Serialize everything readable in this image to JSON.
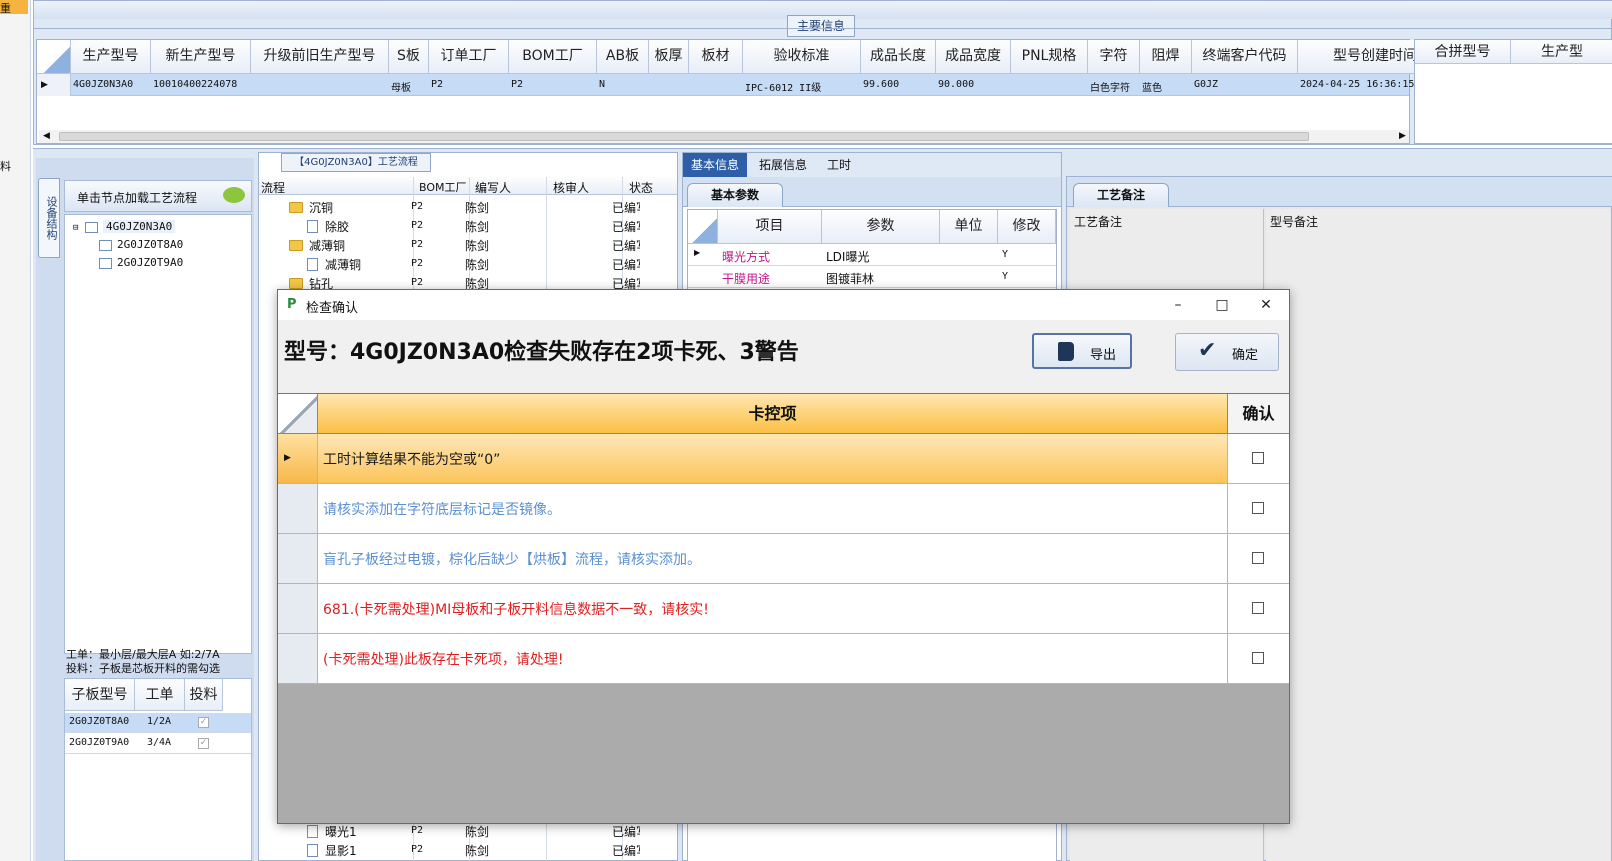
{
  "main_info": {
    "title": "主要信息",
    "columns": [
      "生产型号",
      "新生产型号",
      "升级前旧生产型号",
      "S板",
      "订单工厂",
      "BOM工厂",
      "AB板",
      "板厚",
      "板材",
      "验收标准",
      "成品长度",
      "成品宽度",
      "PNL规格",
      "字符",
      "阻焊",
      "终端客户代码",
      "型号创建时间"
    ],
    "row": [
      "4G0JZ0N3A0",
      "10010400224078",
      "",
      "母板",
      "P2",
      "P2",
      "N",
      "",
      "",
      "IPC-6012 II级",
      "99.600",
      "90.000",
      "",
      "白色字符",
      "蓝色",
      "G0JZ",
      "2024-04-25 16:36:15"
    ],
    "extra_columns": [
      "合拼型号",
      "生产型"
    ]
  },
  "left_panel": {
    "vertical_tab": "设备结构",
    "hint": "单击节点加载工艺流程",
    "tree": [
      "4G0JZ0N3A0",
      "2G0JZ0T8A0",
      "2G0JZ0T9A0"
    ],
    "note_line1": "工单：最小层/最大层A 如:2/7A",
    "note_line2": "投料：子板是芯板开料的需勾选",
    "sub_columns": [
      "子板型号",
      "工单",
      "投料"
    ],
    "sub_rows": [
      {
        "model": "2G0JZ0T8A0",
        "order": "1/2A"
      },
      {
        "model": "2G0JZ0T9A0",
        "order": "3/4A"
      }
    ]
  },
  "flow": {
    "title": "【4G0JZ0N3A0】工艺流程",
    "columns": [
      "流程",
      "BOM工厂",
      "编写人",
      "核审人",
      "状态"
    ],
    "rows": [
      {
        "name": "沉铜",
        "factory": "P2",
        "writer": "陈剑",
        "status": "已编写"
      },
      {
        "name": "除胶",
        "factory": "P2",
        "writer": "陈剑",
        "status": "已编写"
      },
      {
        "name": "减薄铜",
        "factory": "P2",
        "writer": "陈剑",
        "status": "已编写"
      },
      {
        "name": "减薄铜",
        "factory": "P2",
        "writer": "陈剑",
        "status": "已编写"
      },
      {
        "name": "钻孔",
        "factory": "P2",
        "writer": "陈剑",
        "status": "已编写"
      }
    ],
    "bottom_rows": [
      {
        "name": "曝光1",
        "factory": "P2",
        "writer": "陈剑",
        "status": "已编写"
      },
      {
        "name": "显影1",
        "factory": "P2",
        "writer": "陈剑",
        "status": "已编写"
      }
    ]
  },
  "info_tabs": [
    "基本信息",
    "拓展信息",
    "工时"
  ],
  "basic_params": {
    "tab": "基本参数",
    "columns": [
      "项目",
      "参数",
      "单位",
      "修改"
    ],
    "rows": [
      {
        "item": "曝光方式",
        "param": "LDI曝光",
        "unit": "",
        "modify": "Y"
      },
      {
        "item": "干膜用途",
        "param": "图镀菲林",
        "unit": "",
        "modify": "Y"
      }
    ]
  },
  "remarks": {
    "tab": "工艺备注",
    "col1": "工艺备注",
    "col2": "型号备注"
  },
  "dialog": {
    "title": "检查确认",
    "headline": "型号：4G0JZ0N3A0检查失败存在2项卡死、3警告",
    "export_label": "导出",
    "confirm_label": "确定",
    "col_item": "卡控项",
    "col_confirm": "确认",
    "items": [
      {
        "text": "工时计算结果不能为空或“0”",
        "level": "selected",
        "color": "#1a1a1a"
      },
      {
        "text": "请核实添加在字符底层标记是否镜像。",
        "level": "warn",
        "color": "#5b8fd0"
      },
      {
        "text": "盲孔子板经过电镀，棕化后缺少【烘板】流程，请核实添加。",
        "level": "warn",
        "color": "#5b8fd0"
      },
      {
        "text": "681.(卡死需处理)MI母板和子板开料信息数据不一致，请核实!",
        "level": "fatal",
        "color": "#e02020"
      },
      {
        "text": "(卡死需处理)此板存在卡死项，请处理!",
        "level": "fatal",
        "color": "#e02020"
      }
    ]
  },
  "left_edge": {
    "frag1": "重",
    "frag2": "料"
  }
}
